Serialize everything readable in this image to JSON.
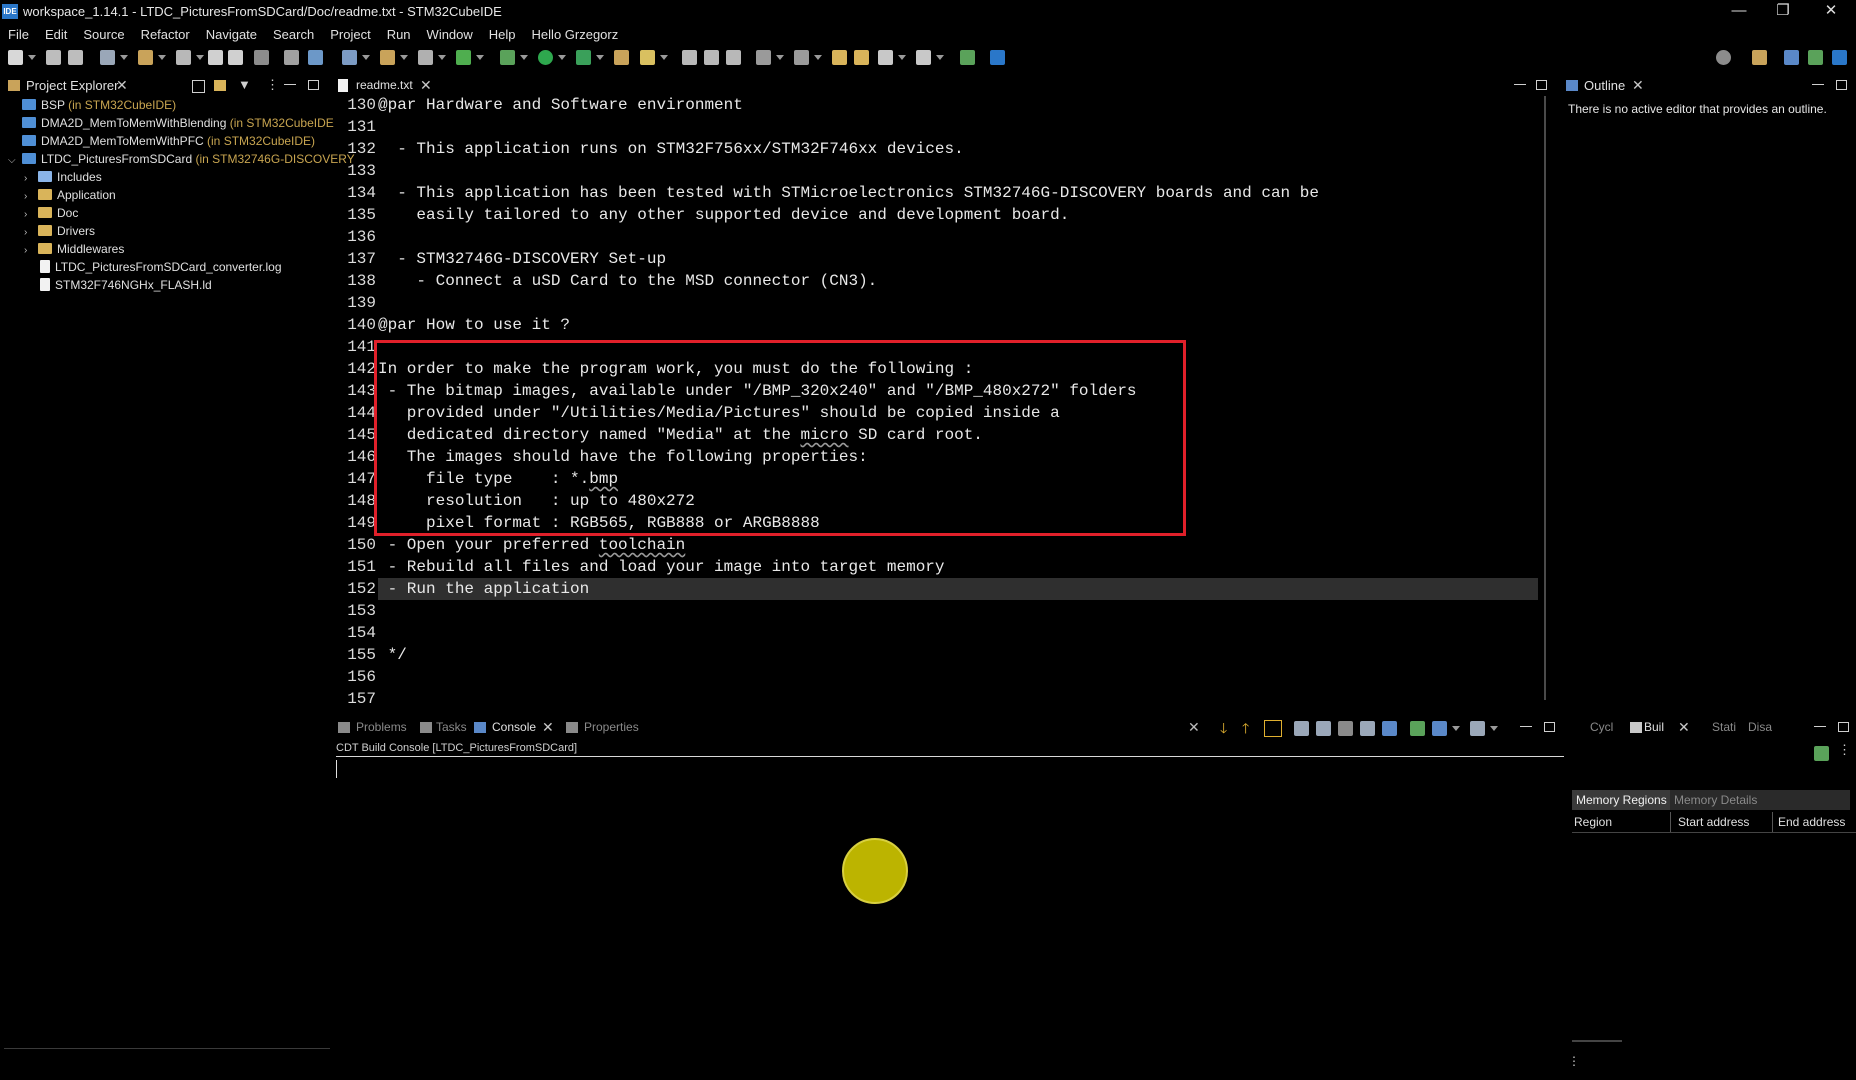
{
  "window": {
    "app_icon": "IDE",
    "title": "workspace_1.14.1 - LTDC_PicturesFromSDCard/Doc/readme.txt - STM32CubeIDE",
    "minimize": "—",
    "restore": "❐",
    "close": "✕"
  },
  "menu": [
    "File",
    "Edit",
    "Source",
    "Refactor",
    "Navigate",
    "Search",
    "Project",
    "Run",
    "Window",
    "Help",
    "Hello Grzegorz"
  ],
  "project_explorer": {
    "tab": "Project Explorer",
    "items": [
      {
        "label": "BSP",
        "decor": " (in STM32CubeIDE)"
      },
      {
        "label": "DMA2D_MemToMemWithBlending",
        "decor": " (in STM32CubeIDE"
      },
      {
        "label": "DMA2D_MemToMemWithPFC",
        "decor": " (in STM32CubeIDE)"
      },
      {
        "label": "LTDC_PicturesFromSDCard",
        "decor": " (in STM32746G-DISCOVERY"
      },
      {
        "label": "Includes",
        "decor": ""
      },
      {
        "label": "Application",
        "decor": ""
      },
      {
        "label": "Doc",
        "decor": ""
      },
      {
        "label": "Drivers",
        "decor": ""
      },
      {
        "label": "Middlewares",
        "decor": ""
      },
      {
        "label": "LTDC_PicturesFromSDCard_converter.log",
        "decor": ""
      },
      {
        "label": "STM32F746NGHx_FLASH.ld",
        "decor": ""
      }
    ]
  },
  "editor": {
    "tab": "readme.txt",
    "lines": [
      {
        "n": "130",
        "text": "@par Hardware and Software environment"
      },
      {
        "n": "131",
        "text": ""
      },
      {
        "n": "132",
        "text": "  - This application runs on STM32F756xx/STM32F746xx devices."
      },
      {
        "n": "133",
        "text": ""
      },
      {
        "n": "134",
        "text": "  - This application has been tested with STMicroelectronics STM32746G-DISCOVERY boards and can be"
      },
      {
        "n": "135",
        "text": "    easily tailored to any other supported device and development board."
      },
      {
        "n": "136",
        "text": ""
      },
      {
        "n": "137",
        "text": "  - STM32746G-DISCOVERY Set-up"
      },
      {
        "n": "138",
        "text": "    - Connect a uSD Card to the MSD connector (CN3)."
      },
      {
        "n": "139",
        "text": ""
      },
      {
        "n": "140",
        "text": "@par How to use it ?"
      },
      {
        "n": "141",
        "text": ""
      },
      {
        "n": "142",
        "text": "In order to make the program work, you must do the following :"
      },
      {
        "n": "143",
        "text": " - The bitmap images, available under \"/BMP_320x240\" and \"/BMP_480x272\" folders"
      },
      {
        "n": "144",
        "text": "   provided under \"/Utilities/Media/Pictures\" should be copied inside a"
      },
      {
        "n": "145",
        "text": "   dedicated directory named \"Media\" at the micro SD card root."
      },
      {
        "n": "146",
        "text": "   The images should have the following properties:"
      },
      {
        "n": "147",
        "text": "     file type    : *.bmp"
      },
      {
        "n": "148",
        "text": "     resolution   : up to 480x272"
      },
      {
        "n": "149",
        "text": "     pixel format : RGB565, RGB888 or ARGB8888"
      },
      {
        "n": "150",
        "text": " - Open your preferred toolchain"
      },
      {
        "n": "151",
        "text": " - Rebuild all files and load your image into target memory"
      },
      {
        "n": "152",
        "text": " - Run the application"
      },
      {
        "n": "153",
        "text": ""
      },
      {
        "n": "154",
        "text": ""
      },
      {
        "n": "155",
        "text": " */"
      },
      {
        "n": "156",
        "text": ""
      },
      {
        "n": "157",
        "text": ""
      }
    ]
  },
  "outline": {
    "tab": "Outline",
    "message": "There is no active editor that provides an outline."
  },
  "bottom_panel": {
    "tabs": [
      "Problems",
      "Tasks",
      "Console",
      "Properties"
    ],
    "console_title": "CDT Build Console [LTDC_PicturesFromSDCard]"
  },
  "build_panel": {
    "tabs": [
      "Cycl",
      "Buil",
      "Stati",
      "Disa"
    ],
    "subtabs": [
      "Memory Regions",
      "Memory Details"
    ],
    "columns": [
      "Region",
      "Start address",
      "End address"
    ]
  },
  "colors": {
    "background": "#000000",
    "highlight_box": "#e0202a",
    "cursor_marker": "#bcb400",
    "current_line": "#2f2f2f"
  }
}
